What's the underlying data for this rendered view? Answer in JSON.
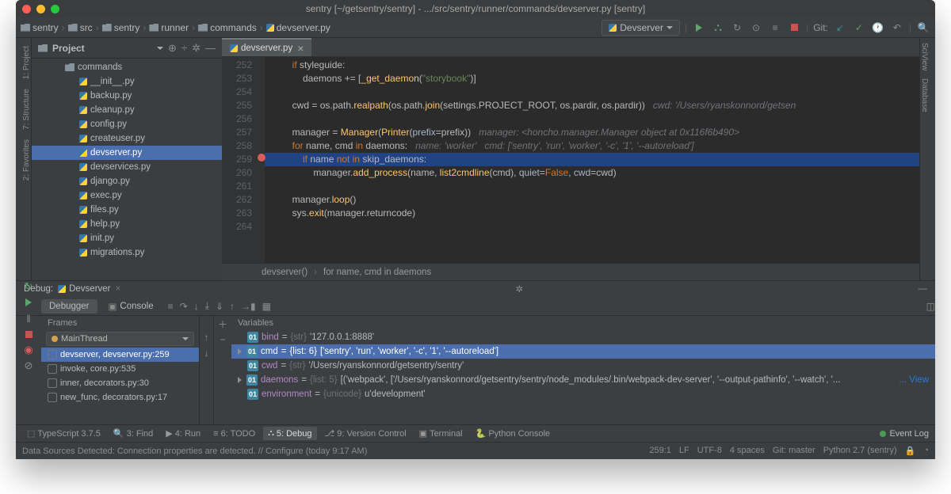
{
  "window": {
    "title": "sentry [~/getsentry/sentry] - .../src/sentry/runner/commands/devserver.py [sentry]"
  },
  "breadcrumbs": [
    "sentry",
    "src",
    "sentry",
    "runner",
    "commands",
    "devserver.py"
  ],
  "run_config": "Devserver",
  "git_label": "Git:",
  "sidebar": {
    "title": "Project",
    "expanded_folder": "commands",
    "items": [
      "__init__.py",
      "backup.py",
      "cleanup.py",
      "config.py",
      "createuser.py",
      "devserver.py",
      "devservices.py",
      "django.py",
      "exec.py",
      "files.py",
      "help.py",
      "init.py",
      "migrations.py"
    ],
    "selected_index": 5
  },
  "editor": {
    "tab_name": "devserver.py",
    "breadcrumb": [
      "devserver()",
      "for name, cmd in daemons"
    ],
    "lines": [
      {
        "n": 252,
        "html": "        <span class='kw'>if</span> styleguide:"
      },
      {
        "n": 253,
        "html": "            daemons += [<span class='fn'>_get_daemon</span>(<span class='str'>\"storybook\"</span>)]"
      },
      {
        "n": 254,
        "html": ""
      },
      {
        "n": 255,
        "html": "        cwd = os.path.<span class='fn'>realpath</span>(os.path.<span class='fn'>join</span>(settings.PROJECT_ROOT, os.pardir, os.pardir))   <span class='cmt2'>cwd: '/Users/ryanskonnord/getsen</span>"
      },
      {
        "n": 256,
        "html": ""
      },
      {
        "n": 257,
        "html": "        manager = <span class='fn'>Manager</span>(<span class='fn'>Printer</span>(<span class='par'>prefix</span>=prefix))   <span class='cmt2'>manager: &lt;honcho.manager.Manager object at 0x116f6b490&gt;</span>"
      },
      {
        "n": 258,
        "html": "        <span class='kw'>for</span> name, cmd <span class='kw'>in</span> daemons:   <span class='cmt2'>name: 'worker'   cmd: ['sentry', 'run', 'worker', '-c', '1', '--autoreload']</span>"
      },
      {
        "n": 259,
        "html": "            <span class='kw'>if</span> name <span class='kw'>not in</span> skip_daemons:",
        "hl": true,
        "bp": true
      },
      {
        "n": 260,
        "html": "                manager.<span class='fn'>add_process</span>(name, <span class='fn'>list2cmdline</span>(cmd), <span class='par'>quiet</span>=<span class='true'>False</span>, <span class='par'>cwd</span>=cwd)"
      },
      {
        "n": 261,
        "html": ""
      },
      {
        "n": 262,
        "html": "        manager.<span class='fn'>loop</span>()"
      },
      {
        "n": 263,
        "html": "        sys.<span class='fn'>exit</span>(manager.returncode)"
      },
      {
        "n": 264,
        "html": ""
      }
    ]
  },
  "debug": {
    "label": "Debug:",
    "config": "Devserver",
    "tabs": [
      "Debugger",
      "Console"
    ],
    "frames_label": "Frames",
    "vars_label": "Variables",
    "thread": "MainThread",
    "frames": [
      {
        "text": "devserver, devserver.py:259",
        "selected": true
      },
      {
        "text": "invoke, core.py:535"
      },
      {
        "text": "inner, decorators.py:30"
      },
      {
        "text": "new_func, decorators.py:17"
      }
    ],
    "variables": [
      {
        "name": "bind",
        "type": "{str}",
        "value": "'127.0.0.1:8888'"
      },
      {
        "name": "cmd",
        "type": "{list: 6}",
        "value": "['sentry', 'run', 'worker', '-c', '1', '--autoreload']",
        "selected": true,
        "expand": true
      },
      {
        "name": "cwd",
        "type": "{str}",
        "value": "'/Users/ryanskonnord/getsentry/sentry'"
      },
      {
        "name": "daemons",
        "type": "{list: 5}",
        "value": "[('webpack', ['/Users/ryanskonnord/getsentry/sentry/node_modules/.bin/webpack-dev-server', '--output-pathinfo', '--watch', '...",
        "expand": true,
        "view": "View"
      },
      {
        "name": "environment",
        "type": "{unicode}",
        "value": "u'development'"
      }
    ]
  },
  "bottom_tabs": [
    {
      "label": "TypeScript 3.7.5",
      "icon": "⬚"
    },
    {
      "label": "3: Find",
      "icon": "🔍"
    },
    {
      "label": "4: Run",
      "icon": "▶"
    },
    {
      "label": "6: TODO",
      "icon": "≡"
    },
    {
      "label": "5: Debug",
      "icon": "⛬",
      "active": true
    },
    {
      "label": "9: Version Control",
      "icon": "⎇"
    },
    {
      "label": "Terminal",
      "icon": "▣"
    },
    {
      "label": "Python Console",
      "icon": "🐍"
    }
  ],
  "event_log": "Event Log",
  "status": {
    "message": "Data Sources Detected: Connection properties are detected. // Configure (today 9:17 AM)",
    "pos": "259:1",
    "eol": "LF",
    "enc": "UTF-8",
    "indent": "4 spaces",
    "git": "Git: master",
    "python": "Python 2.7 (sentry)"
  },
  "left_tabs": [
    "1: Project",
    "7: Structure",
    "2: Favorites"
  ],
  "right_tabs": [
    "SciView",
    "Database"
  ]
}
